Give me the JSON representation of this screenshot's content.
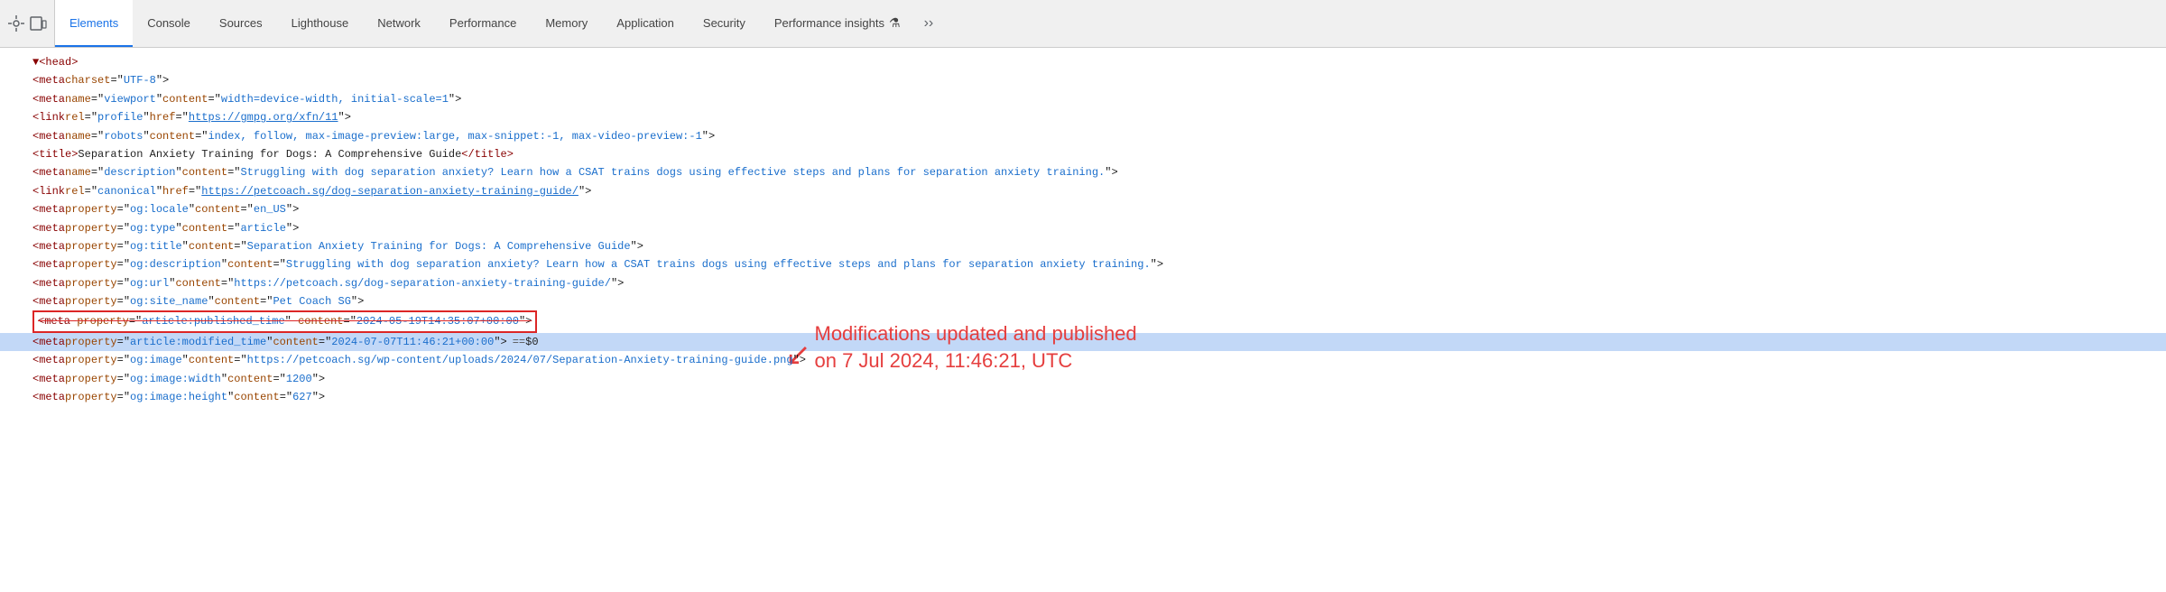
{
  "tabs": [
    {
      "id": "devtools-inspect",
      "label": "⚙",
      "icon": true
    },
    {
      "id": "devtools-device",
      "label": "☐",
      "icon": true
    },
    {
      "id": "elements",
      "label": "Elements",
      "active": true
    },
    {
      "id": "console",
      "label": "Console"
    },
    {
      "id": "sources",
      "label": "Sources"
    },
    {
      "id": "lighthouse",
      "label": "Lighthouse"
    },
    {
      "id": "network",
      "label": "Network"
    },
    {
      "id": "performance",
      "label": "Performance"
    },
    {
      "id": "memory",
      "label": "Memory"
    },
    {
      "id": "application",
      "label": "Application"
    },
    {
      "id": "security",
      "label": "Security"
    },
    {
      "id": "performance-insights",
      "label": "Performance insights ⚗"
    }
  ],
  "code": {
    "lines": [
      {
        "indent": 0,
        "content": "▼ <head>"
      },
      {
        "indent": 1,
        "content": "<meta charset=\"UTF-8\">"
      },
      {
        "indent": 1,
        "content": "<meta name=\"viewport\" content=\"width=device-width, initial-scale=1\">"
      },
      {
        "indent": 1,
        "content": "<link rel=\"profile\" href=\"https://gmpg.org/xfn/11\">"
      },
      {
        "indent": 1,
        "content": "<meta name=\"robots\" content=\"index, follow, max-image-preview:large, max-snippet:-1, max-video-preview:-1\">"
      },
      {
        "indent": 1,
        "content": "<title>Separation Anxiety Training for Dogs: A Comprehensive Guide</title>"
      },
      {
        "indent": 1,
        "content": "<meta name=\"description\" content=\"Struggling with dog separation anxiety? Learn how a CSAT trains dogs using effective steps and plans for separation anxiety training.\">"
      },
      {
        "indent": 1,
        "content": "<link rel=\"canonical\" href=\"https://petcoach.sg/dog-separation-anxiety-training-guide/\">"
      },
      {
        "indent": 1,
        "content": "<meta property=\"og:locale\" content=\"en_US\">"
      },
      {
        "indent": 1,
        "content": "<meta property=\"og:type\" content=\"article\">"
      },
      {
        "indent": 1,
        "content": "<meta property=\"og:title\" content=\"Separation Anxiety Training for Dogs: A Comprehensive Guide\">"
      },
      {
        "indent": 1,
        "content": "<meta property=\"og:description\" content=\"Struggling with dog separation anxiety? Learn how a CSAT trains dogs using effective steps and plans for separation anxiety training.\">"
      },
      {
        "indent": 1,
        "content": "<meta property=\"og:url\" content=\"https://petcoach.sg/dog-separation-anxiety-training-guide/\">"
      },
      {
        "indent": 1,
        "content": "<meta property=\"og:site_name\" content=\"Pet Coach SG\">"
      },
      {
        "indent": 1,
        "content": "<meta property=\"article:published_time\" content=\"2024-05-19T14:35:07+00:00\">",
        "strikethrough": true,
        "redbox": true
      },
      {
        "indent": 1,
        "content": "<meta property=\"article:modified_time\" content=\"2024-07-07T11:46:21+00:00\"> == $0",
        "selected": true,
        "hasDot": true
      },
      {
        "indent": 1,
        "content": "<meta property=\"og:image\" content=\"https://petcoach.sg/wp-content/uploads/2024/07/Separation-Anxiety-training-guide.png\">"
      },
      {
        "indent": 1,
        "content": "<meta property=\"og:image:width\" content=\"1200\">"
      },
      {
        "indent": 1,
        "content": "<meta property=\"og:image:height\" content=\"627\">"
      }
    ],
    "annotation": {
      "text": "Modifications updated and published\non 7 Jul 2024, 11:46:21, UTC",
      "arrow": "↙"
    }
  }
}
